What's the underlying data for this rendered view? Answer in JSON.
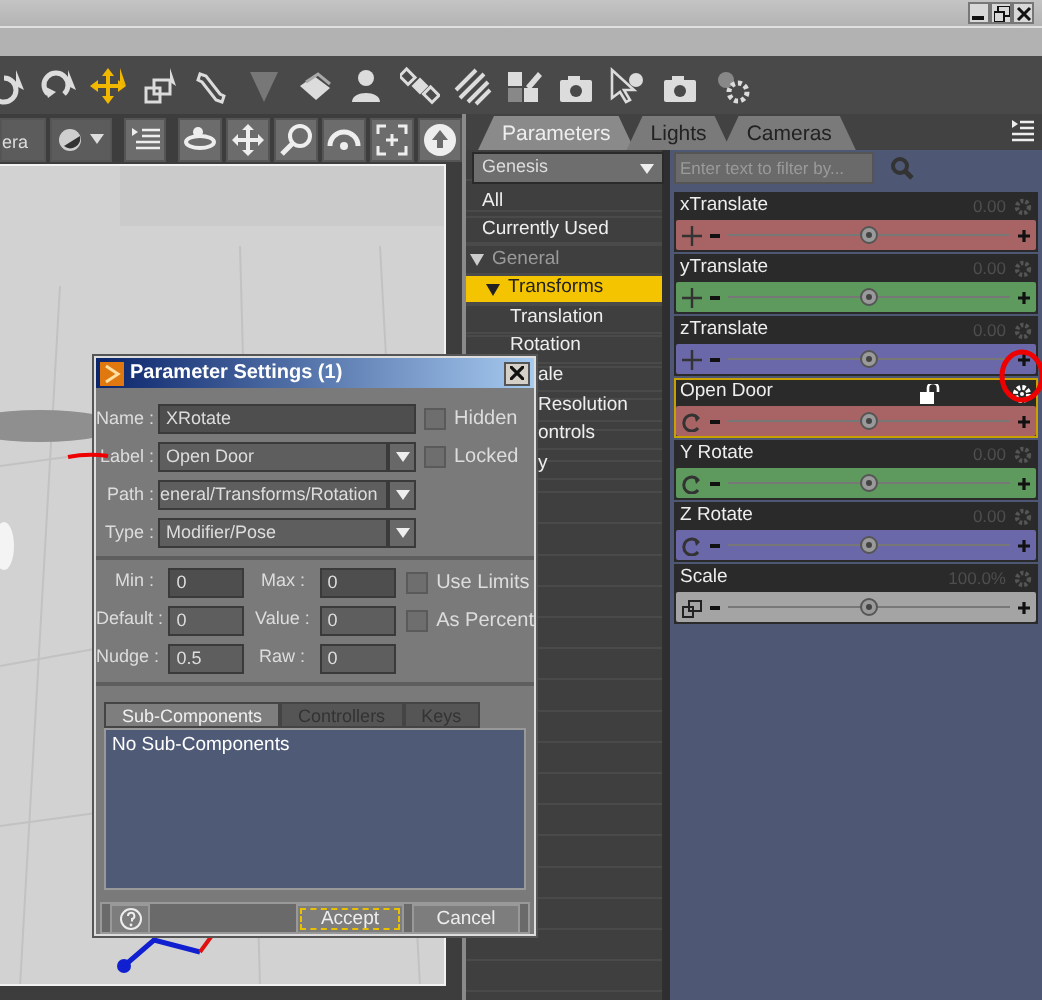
{
  "tools": [
    {
      "kind": "rotate-pose",
      "selected": false
    },
    {
      "kind": "rotate",
      "selected": false
    },
    {
      "kind": "move",
      "selected": true
    },
    {
      "kind": "scale",
      "selected": false
    },
    {
      "kind": "bone",
      "selected": false
    },
    {
      "kind": "cone",
      "selected": false
    },
    {
      "kind": "cards",
      "selected": false
    },
    {
      "kind": "person",
      "selected": false
    },
    {
      "kind": "satellite",
      "selected": false
    },
    {
      "kind": "hatch",
      "selected": false
    },
    {
      "kind": "pencil",
      "selected": false
    },
    {
      "kind": "camera",
      "selected": false
    },
    {
      "kind": "cursor-gear",
      "selected": false
    },
    {
      "kind": "camera",
      "selected": false
    },
    {
      "kind": "gears",
      "selected": false
    }
  ],
  "viewport_toolbar": {
    "camera": "era",
    "views": [
      {
        "kind": "orbit"
      },
      {
        "kind": "move"
      },
      {
        "kind": "zoom"
      },
      {
        "kind": "arc"
      },
      {
        "kind": "frame"
      },
      {
        "kind": "home"
      }
    ]
  },
  "panel_tabs": [
    {
      "label": "Parameters",
      "selected": true
    },
    {
      "label": "Lights",
      "selected": false
    },
    {
      "label": "Cameras",
      "selected": false
    }
  ],
  "node_select": "Genesis",
  "groups": [
    {
      "label": "All",
      "kind": "item",
      "selected": false
    },
    {
      "label": "Currently Used",
      "kind": "item",
      "selected": false
    },
    {
      "label": "General",
      "kind": "header",
      "selected": false
    },
    {
      "label": "Transforms",
      "kind": "sub",
      "selected": true
    },
    {
      "label": "Translation",
      "kind": "leaf",
      "selected": false
    },
    {
      "label": "Rotation",
      "kind": "leaf",
      "selected": false
    },
    {
      "label": "ale",
      "kind": "covered",
      "selected": false
    },
    {
      "label": "Resolution",
      "kind": "covered",
      "selected": false
    },
    {
      "label": "ontrols",
      "kind": "covered",
      "selected": false
    },
    {
      "label": "y",
      "kind": "covered",
      "selected": false
    }
  ],
  "filter": {
    "placeholder": "Enter text to filter by..."
  },
  "parameters": [
    {
      "name": "xTranslate",
      "value": "0.00",
      "kind": "translate",
      "color": "#a86464",
      "level": 0.5,
      "selected": false
    },
    {
      "name": "yTranslate",
      "value": "0.00",
      "kind": "translate",
      "color": "#5e9a5e",
      "level": 0.5,
      "selected": false
    },
    {
      "name": "zTranslate",
      "value": "0.00",
      "kind": "translate",
      "color": "#6a68a8",
      "level": 0.5,
      "selected": false
    },
    {
      "name": "Open Door",
      "kind": "rotate",
      "color": "#a86464",
      "level": 0.5,
      "selected": true
    },
    {
      "name": "Y Rotate",
      "value": "0.00",
      "kind": "rotate",
      "color": "#5e9a5e",
      "level": 0.5,
      "selected": false
    },
    {
      "name": "Z Rotate",
      "value": "0.00",
      "kind": "rotate",
      "color": "#6a68a8",
      "level": 0.5,
      "selected": false
    },
    {
      "name": "Scale",
      "value": "100.0%",
      "kind": "scale",
      "color": "#a4a4a4",
      "level": 0.5,
      "selected": false
    }
  ],
  "dialog": {
    "title": "Parameter Settings (1)",
    "fields": [
      {
        "label": "Name :",
        "value": "XRotate",
        "kind": "text"
      },
      {
        "label": "Label :",
        "value": "Open Door",
        "kind": "combo"
      },
      {
        "label": "Path :",
        "value": "eneral/Transforms/Rotation",
        "kind": "combo"
      },
      {
        "label": "Type :",
        "value": "Modifier/Pose",
        "kind": "combo"
      }
    ],
    "checks": [
      {
        "label": "Hidden",
        "checked": false
      },
      {
        "label": "Locked",
        "checked": false
      }
    ],
    "numbers": [
      {
        "label": "Min :",
        "value": "0"
      },
      {
        "label": "Max :",
        "value": "0"
      },
      {
        "label": "Default :",
        "value": "0"
      },
      {
        "label": "Value :",
        "value": "0"
      },
      {
        "label": "Nudge :",
        "value": "0.5"
      },
      {
        "label": "Raw :",
        "value": "0"
      }
    ],
    "limit_checks": [
      {
        "label": "Use Limits",
        "checked": false
      },
      {
        "label": "As Percent",
        "checked": false
      }
    ],
    "tabs": [
      {
        "label": "Sub-Components",
        "selected": true
      },
      {
        "label": "Controllers",
        "selected": false
      },
      {
        "label": "Keys",
        "selected": false
      }
    ],
    "tab_text": "No Sub-Components",
    "buttons": [
      {
        "label": "Accept",
        "focused": true
      },
      {
        "label": "Cancel",
        "focused": false
      }
    ]
  }
}
